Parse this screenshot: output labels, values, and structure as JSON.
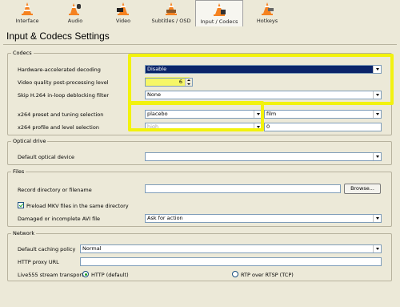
{
  "tabs": [
    {
      "label": "Interface",
      "icon": "vlc-cone-icon"
    },
    {
      "label": "Audio",
      "icon": "audio-cone-icon"
    },
    {
      "label": "Video",
      "icon": "video-cone-icon"
    },
    {
      "label": "Subtitles / OSD",
      "icon": "subtitles-cone-icon"
    },
    {
      "label": "Input / Codecs",
      "icon": "input-codecs-cone-icon"
    },
    {
      "label": "Hotkeys",
      "icon": "hotkeys-cone-icon"
    }
  ],
  "title": "Input & Codecs Settings",
  "codecs": {
    "legend": "Codecs",
    "hw_decoding_label": "Hardware-accelerated decoding",
    "hw_decoding_value": "Disable",
    "video_quality_label": "Video quality post-processing level",
    "video_quality_value": "6",
    "skip_h264_label": "Skip H.264 in-loop deblocking filter",
    "skip_h264_value": "None",
    "x264_preset_label": "x264 preset and tuning selection",
    "x264_preset_value": "placebo",
    "x264_tune_value": "film",
    "x264_profile_label": "x264 profile and level selection",
    "x264_profile_value": "high",
    "x264_level_value": "0"
  },
  "optical": {
    "legend": "Optical drive",
    "device_label": "Default optical device",
    "device_value": ""
  },
  "files": {
    "legend": "Files",
    "record_label": "Record directory or filename",
    "record_value": "",
    "browse_label": "Browse...",
    "preload_label": "Preload MKV files in the same directory",
    "damaged_label": "Damaged or incomplete AVI file",
    "damaged_value": "Ask for action"
  },
  "network": {
    "legend": "Network",
    "caching_label": "Default caching policy",
    "caching_value": "Normal",
    "proxy_label": "HTTP proxy URL",
    "proxy_value": "",
    "transport_label": "Live555 stream transport",
    "http_option": "HTTP (default)",
    "rtp_option": "RTP over RTSP (TCP)"
  },
  "colors": {
    "highlight": "#f2f20d",
    "selection": "#0a246a",
    "background": "#ece9d8"
  }
}
